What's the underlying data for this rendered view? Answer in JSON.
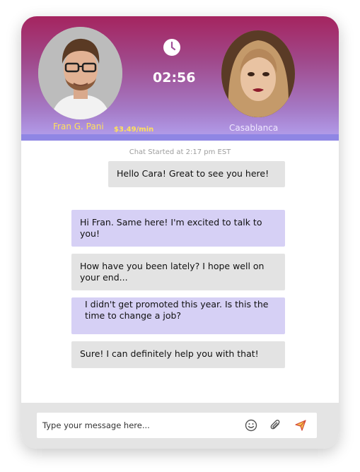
{
  "caller": {
    "name": "Fran G. Pani",
    "rate": "$3.49/min"
  },
  "callee": {
    "name": "Casablanca"
  },
  "timer": "02:56",
  "chat": {
    "started": "Chat Started at 2:17 pm EST",
    "messages": [
      {
        "text": "Hello Cara! Great to see you here!",
        "style": "gray"
      },
      {
        "text": "Hi Fran. Same here! I'm excited to talk to you!",
        "style": "purple"
      },
      {
        "text": "How have you been lately? I hope well on your end...",
        "style": "gray"
      },
      {
        "text": "I didn't get promoted this year. Is this the time to change a job?",
        "style": "purple"
      },
      {
        "text": "Sure! I can definitely help you with that!",
        "style": "gray"
      }
    ]
  },
  "composer": {
    "placeholder": "Type your message here..."
  },
  "icons": {
    "clock": "clock-icon",
    "emoji": "smiley-icon",
    "attach": "paperclip-icon",
    "send": "paper-plane-icon"
  },
  "colors": {
    "header_top": "#a5245f",
    "header_bottom": "#b4a2f0",
    "name_yellow": "#ffe15a",
    "bubble_gray": "#e3e3e3",
    "bubble_purple": "#d6d0f5"
  }
}
